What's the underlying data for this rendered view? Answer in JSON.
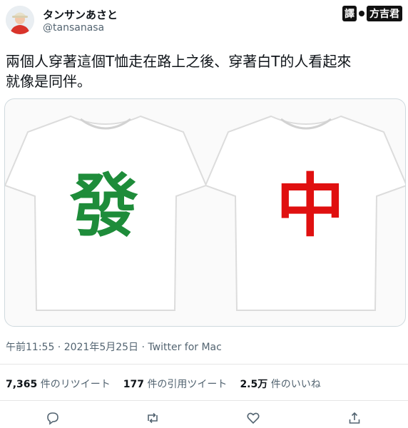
{
  "user": {
    "display_name": "タンサンあさと",
    "handle": "@tansanasa"
  },
  "watermark": {
    "label": "譯",
    "names": "方吉君"
  },
  "tweet": {
    "text_line1": "兩個人穿著這個T恤走在路上之後、穿著白T的人看起來",
    "text_line2": "就像是同伴。"
  },
  "media": {
    "left_shirt_char": "發",
    "right_shirt_char": "中",
    "left_color": "#1e8c3a",
    "right_color": "#e01010"
  },
  "meta": {
    "timestamp": "午前11:55 · 2021年5月25日 · Twitter for Mac"
  },
  "stats": {
    "retweets_count": "7,365",
    "retweets_label": "件のリツイート",
    "quotes_count": "177",
    "quotes_label": "件の引用ツイート",
    "likes_count": "2.5万",
    "likes_label": "件のいいね"
  },
  "actions": [
    "reply-icon",
    "retweet-icon",
    "like-icon",
    "share-icon"
  ]
}
